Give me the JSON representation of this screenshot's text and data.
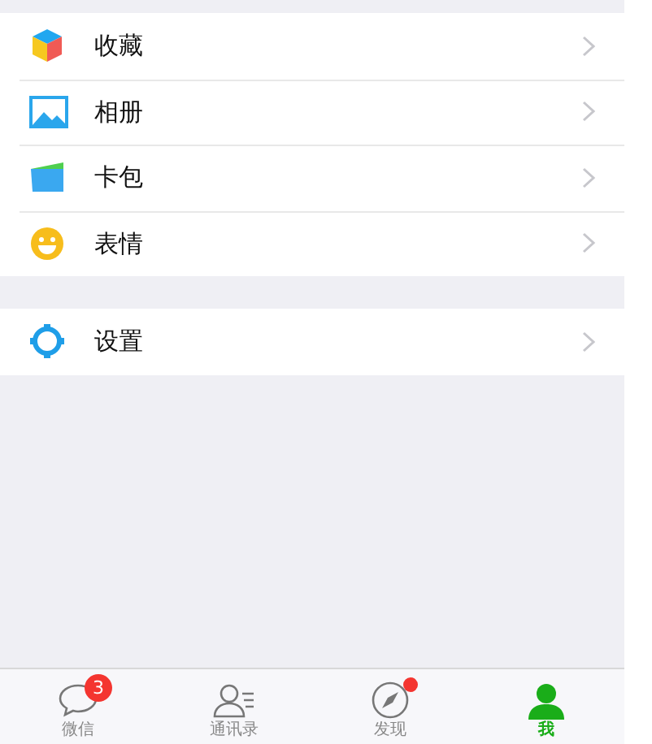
{
  "groups": [
    {
      "items": [
        {
          "label": "收藏"
        },
        {
          "label": "相册"
        },
        {
          "label": "卡包"
        },
        {
          "label": "表情"
        }
      ]
    },
    {
      "items": [
        {
          "label": "设置"
        }
      ]
    }
  ],
  "tabs": [
    {
      "label": "微信",
      "selected": false,
      "badge": "3",
      "dot": false
    },
    {
      "label": "通讯录",
      "selected": false,
      "dot": false
    },
    {
      "label": "发现",
      "selected": false,
      "dot": true
    },
    {
      "label": "我",
      "selected": true,
      "dot": false
    }
  ]
}
